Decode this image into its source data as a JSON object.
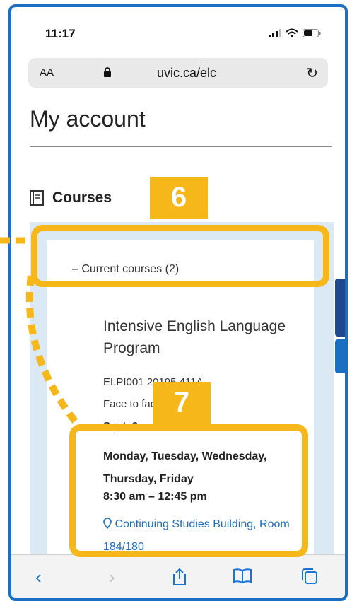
{
  "status_bar": {
    "time": "11:17"
  },
  "browser": {
    "text_size_label": "AA",
    "url": "uvic.ca/elc"
  },
  "page": {
    "title": "My account"
  },
  "courses": {
    "heading": "Courses",
    "current_toggle": "– Current courses (2)",
    "course": {
      "title": "Intensive English Language Program",
      "code": "ELPI001 20195 411A",
      "mode": "Face to face",
      "dates": "Sept. 9 – … 2019",
      "days": "Monday, Tuesday, Wednesday, Thursday, Friday",
      "time": "8:30 am – 12:45 pm",
      "location": "Continuing Studies Building, Room 184/180"
    }
  },
  "annotations": {
    "badge_6": "6",
    "badge_7": "7"
  },
  "colors": {
    "accent": "#f5b71a",
    "link": "#1a6fc2",
    "panel": "#dbe9f5"
  }
}
